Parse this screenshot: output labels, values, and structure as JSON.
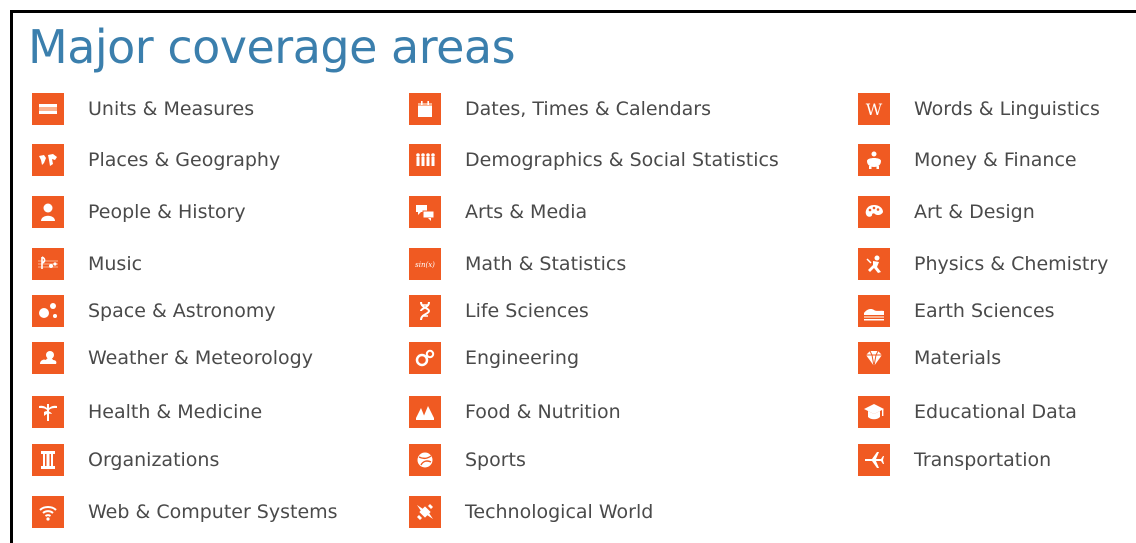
{
  "heading": "Major coverage areas",
  "colors": {
    "heading": "#3b7fad",
    "icon_bg": "#f05a22",
    "label": "#4a4a4a"
  },
  "columns": [
    {
      "items": [
        {
          "label": "Units & Measures",
          "icon": "ruler-icon"
        },
        {
          "label": "Places & Geography",
          "icon": "world-map-icon"
        },
        {
          "label": "People & History",
          "icon": "person-bust-icon"
        },
        {
          "label": "Music",
          "icon": "music-staff-icon"
        },
        {
          "label": "Space & Astronomy",
          "icon": "planets-icon"
        },
        {
          "label": "Weather & Meteorology",
          "icon": "sun-cloud-icon"
        },
        {
          "label": "Health & Medicine",
          "icon": "caduceus-icon"
        },
        {
          "label": "Organizations",
          "icon": "column-icon"
        },
        {
          "label": "Web & Computer Systems",
          "icon": "wifi-icon"
        }
      ]
    },
    {
      "items": [
        {
          "label": "Dates, Times & Calendars",
          "icon": "calendar-icon"
        },
        {
          "label": "Demographics & Social Statistics",
          "icon": "people-group-icon"
        },
        {
          "label": "Arts & Media",
          "icon": "speech-bubbles-icon"
        },
        {
          "label": "Math & Statistics",
          "icon": "math-function-icon",
          "icon_text": "sin(x)"
        },
        {
          "label": "Life Sciences",
          "icon": "dna-icon"
        },
        {
          "label": "Engineering",
          "icon": "gears-icon"
        },
        {
          "label": "Food & Nutrition",
          "icon": "food-icon"
        },
        {
          "label": "Sports",
          "icon": "ball-icon"
        },
        {
          "label": "Technological World",
          "icon": "satellite-icon"
        }
      ]
    },
    {
      "items": [
        {
          "label": "Words & Linguistics",
          "icon": "letter-w-icon",
          "icon_text": "W"
        },
        {
          "label": "Money & Finance",
          "icon": "piggy-bank-icon"
        },
        {
          "label": "Art & Design",
          "icon": "palette-icon"
        },
        {
          "label": "Physics & Chemistry",
          "icon": "atom-figure-icon"
        },
        {
          "label": "Earth Sciences",
          "icon": "terrain-icon"
        },
        {
          "label": "Materials",
          "icon": "diamond-icon"
        },
        {
          "label": "Educational Data",
          "icon": "graduation-cap-icon"
        },
        {
          "label": "Transportation",
          "icon": "airplane-icon"
        }
      ]
    }
  ]
}
